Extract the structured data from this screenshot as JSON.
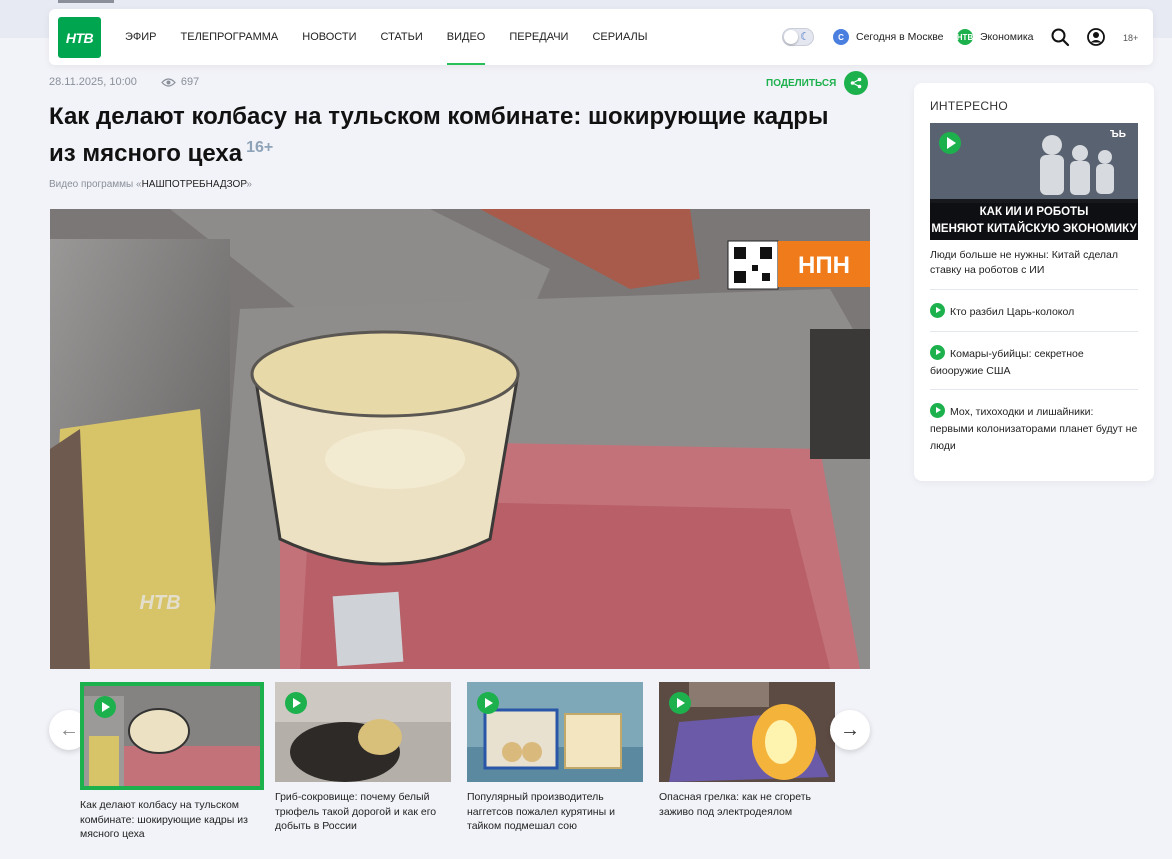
{
  "header": {
    "logo_text": "НТВ",
    "nav": [
      "ЭФИР",
      "ТЕЛЕПРОГРАММА",
      "НОВОСТИ",
      "СТАТЬИ",
      "ВИДЕО",
      "ПЕРЕДАЧИ",
      "СЕРИАЛЫ"
    ],
    "active_nav": "ВИДЕО",
    "today_moscow": "Сегодня в Москве",
    "economy": "Экономика",
    "age": "18+"
  },
  "article": {
    "date": "28.11.2025, 10:00",
    "views": "697",
    "share_label": "ПОДЕЛИТЬСЯ",
    "title": "Как делают колбасу на тульском комбинате: шокирующие кадры из мясного цеха",
    "age_rating": "16+",
    "crumb_prefix": "Видео программы «",
    "crumb_program": "НАШПОТРЕБНАДЗОР",
    "crumb_suffix": "»",
    "video_badge": "НПН",
    "watermark": "НТВ"
  },
  "carousel": [
    {
      "title": "Как делают колбасу на тульском комбинате: шокирующие кадры из мясного цеха"
    },
    {
      "title": "Гриб-сокровище: почему белый трюфель такой дорогой и как его добыть в России"
    },
    {
      "title": "Популярный производитель наггетсов пожалел курятины и тайком подмешал сою"
    },
    {
      "title": "Опасная грелка: как не сгореть заживо под электродеялом"
    }
  ],
  "sidebar": {
    "label": "ИНТЕРЕСНО",
    "feature_overlay_1": "КАК ИИ И РОБОТЫ",
    "feature_overlay_2": "МЕНЯЮТ КИТАЙСКУЮ ЭКОНОМИКУ",
    "feature_badge": "ЪЬ",
    "feature_title": "Люди больше не нужны: Китай сделал ставку на роботов с ИИ",
    "items": [
      {
        "title": "Кто разбил Царь-колокол"
      },
      {
        "title": "Комары-убийцы: секретное биооружие США"
      },
      {
        "title": "Мох, тихоходки и лишайники: первыми колонизаторами планет будут не люди"
      }
    ]
  },
  "colors": {
    "accent": "#1db14d",
    "video_badge": "#f07b1a"
  }
}
